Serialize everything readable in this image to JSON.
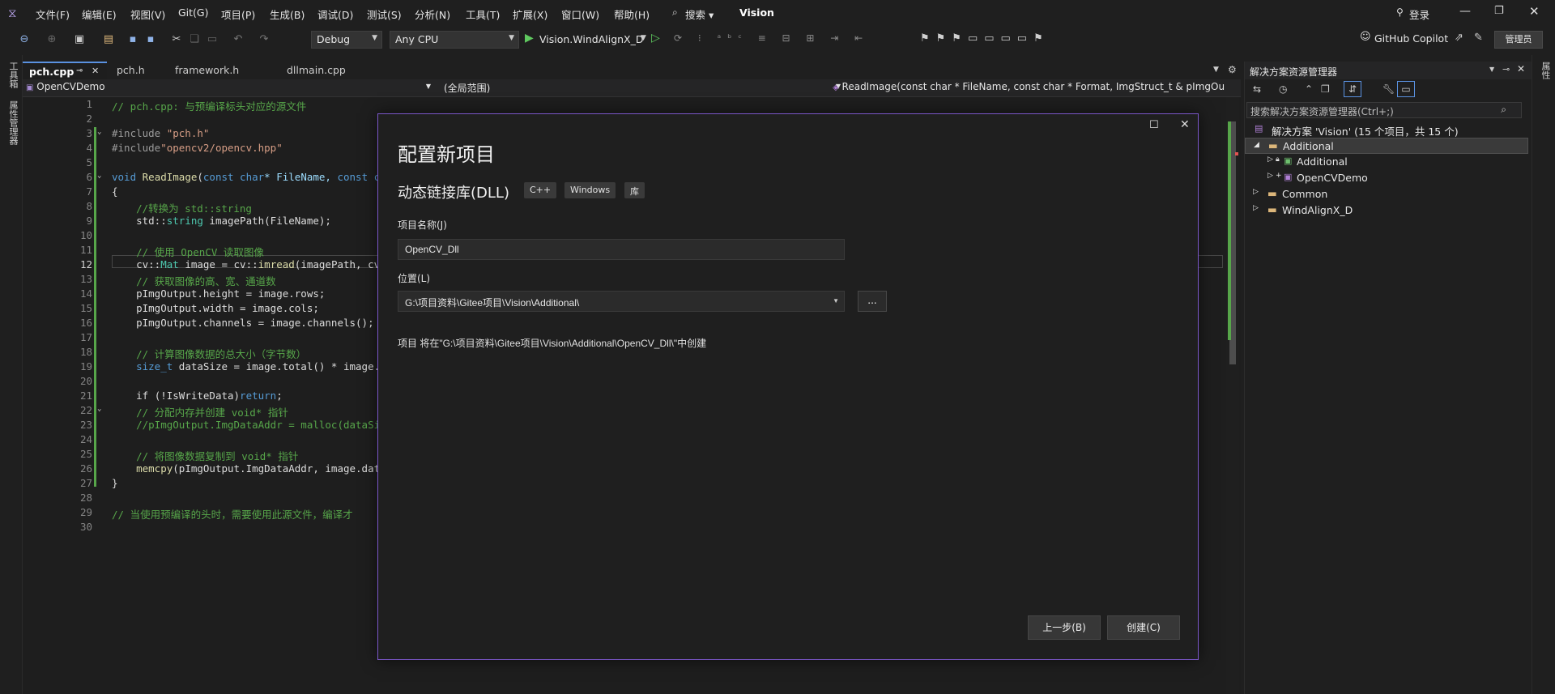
{
  "menu": {
    "items": [
      "文件(F)",
      "编辑(E)",
      "视图(V)",
      "Git(G)",
      "项目(P)",
      "生成(B)",
      "调试(D)",
      "测试(S)",
      "分析(N)",
      "工具(T)",
      "扩展(X)",
      "窗口(W)",
      "帮助(H)"
    ],
    "search_label": "搜索",
    "solution_title": "Vision",
    "login_label": "登录"
  },
  "toolbar": {
    "config": "Debug",
    "platform": "Any CPU",
    "run_target": "Vision.WindAlignX_D",
    "copilot": "GitHub Copilot",
    "admin": "管理员"
  },
  "left_sidebar": {
    "toolbox": "工具箱",
    "properties": "属性管理器"
  },
  "right_sidebar": {
    "label": "属性"
  },
  "tabs": [
    {
      "label": "pch.cpp",
      "active": true
    },
    {
      "label": "pch.h"
    },
    {
      "label": "framework.h"
    },
    {
      "label": "dllmain.cpp"
    }
  ],
  "navbar": {
    "project": "OpenCVDemo",
    "scope": "(全局范围)",
    "member": "ReadImage(const char * FileName, const char * Format, ImgStruct_t & pImgOu"
  },
  "code": {
    "line_numbers": [
      "1",
      "2",
      "3",
      "4",
      "5",
      "6",
      "7",
      "8",
      "9",
      "10",
      "11",
      "12",
      "13",
      "14",
      "15",
      "16",
      "17",
      "18",
      "19",
      "20",
      "21",
      "22",
      "23",
      "24",
      "25",
      "26",
      "27",
      "28",
      "29",
      "30"
    ],
    "current_line": "12",
    "l1": "// pch.cpp: 与预编译标头对应的源文件",
    "l3a": "#include ",
    "l3b": "\"pch.h\"",
    "l4a": "#include",
    "l4b": "\"opencv2/opencv.hpp\"",
    "l6a": "void ",
    "l6b": "ReadImage",
    "l6c": "(",
    "l6d": "const char",
    "l6e": "* FileName, ",
    "l6f": "const cha",
    "l7": "{",
    "l8": "    //转换为 std::string",
    "l9a": "    std::",
    "l9b": "string",
    "l9c": " imagePath(FileName);",
    "l11": "    // 使用 OpenCV 读取图像",
    "l12a": "    cv::",
    "l12b": "Mat",
    "l12c": " image = cv::",
    "l12d": "imread",
    "l12e": "(imagePath, cv::",
    "l13": "    // 获取图像的高、宽、通道数",
    "l14": "    pImgOutput.height = image.rows;",
    "l15": "    pImgOutput.width = image.cols;",
    "l16": "    pImgOutput.channels = image.channels();",
    "l18": "    // 计算图像数据的总大小（字节数）",
    "l19a": "    ",
    "l19b": "size_t",
    "l19c": " dataSize = image.total() * image.el",
    "l21a": "    if ",
    "l21b": "(!IsWriteData)",
    "l21c": "return",
    "l21d": ";",
    "l22": "    // 分配内存并创建 void* 指针",
    "l23": "    //pImgOutput.ImgDataAddr = malloc(dataSize",
    "l25": "    // 将图像数据复制到 void* 指针",
    "l26a": "    ",
    "l26b": "memcpy",
    "l26c": "(pImgOutput.ImgDataAddr, image.data,",
    "l27": "}",
    "l29": "// 当使用预编译的头时，需要使用此源文件，编译才"
  },
  "dialog": {
    "title": "配置新项目",
    "template": "动态链接库(DLL)",
    "tags": [
      "C++",
      "Windows",
      "库"
    ],
    "name_label": "项目名称(J)",
    "name_value": "OpenCV_Dll",
    "location_label": "位置(L)",
    "location_value": "G:\\项目资料\\Gitee项目\\Vision\\Additional\\",
    "browse_label": "...",
    "info": "项目 将在\"G:\\项目资料\\Gitee项目\\Vision\\Additional\\OpenCV_Dll\\\"中创建",
    "back_button": "上一步(B)",
    "create_button": "创建(C)"
  },
  "solution_explorer": {
    "title": "解决方案资源管理器",
    "search_placeholder": "搜索解决方案资源管理器(Ctrl+;)",
    "solution": "解决方案 'Vision' (15 个项目，共 15 个)",
    "items": [
      {
        "label": "Additional",
        "type": "folder"
      },
      {
        "label": "Additional",
        "type": "project"
      },
      {
        "label": "OpenCVDemo",
        "type": "project"
      },
      {
        "label": "Common",
        "type": "folder"
      },
      {
        "label": "WindAlignX_D",
        "type": "folder"
      }
    ]
  }
}
